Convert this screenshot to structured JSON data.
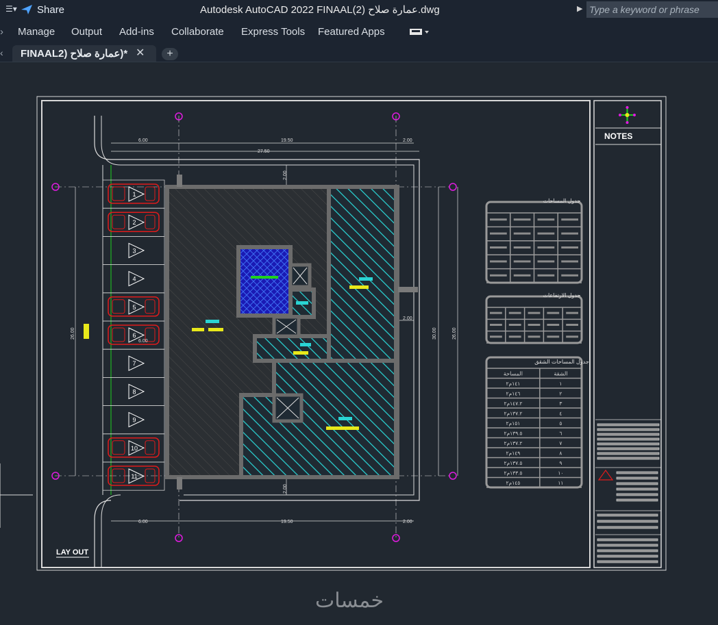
{
  "titlebar": {
    "share_label": "Share",
    "document_title": "Autodesk AutoCAD 2022    FINAALعمارة صلاح (2).dwg",
    "search_placeholder": "Type a keyword or phrase"
  },
  "menu": [
    "Manage",
    "Output",
    "Add-ins",
    "Collaborate",
    "Express Tools",
    "Featured Apps"
  ],
  "tab": {
    "label": "FINAAL2) عمارة صلاح)*"
  },
  "drawing": {
    "title": "LAY OUT",
    "notes_title": "NOTES",
    "dims_top": {
      "left": "6.00",
      "middle": "19.50",
      "right": "2.00",
      "total": "27.50"
    },
    "dims_bottom": {
      "left": "6.00",
      "middle": "19.50",
      "right": "2.00"
    },
    "dims_vertical": {
      "left": "26.00",
      "right_inner": "30.00",
      "right_outer": "26.00",
      "top_gap": "2.00",
      "bottom_gap": "2.00",
      "side_gap": "2.00"
    },
    "parking_width_label": "6.00",
    "parking": [
      "1",
      "2",
      "3",
      "4",
      "5",
      "6",
      "7",
      "8",
      "9",
      "10",
      "11"
    ],
    "cars_in_slots": [
      1,
      2,
      5,
      6,
      10,
      11
    ],
    "table1_title": "جدول المساحات",
    "table2_title": "جدول الارتفاعات",
    "table3_title": "جدول المساحات الشقق",
    "table3_headers": [
      "الشقة",
      "المساحة"
    ],
    "table3_rows": [
      [
        "١",
        "١٤١م٢"
      ],
      [
        "٢",
        "١٤٦م٢"
      ],
      [
        "٣",
        "١٤٧.٢م٢"
      ],
      [
        "٤",
        "١٣٧.٢م٢"
      ],
      [
        "٥",
        "١٥١م٢"
      ],
      [
        "٦",
        "١٣٩.٥م٢"
      ],
      [
        "٧",
        "١٣٧.٢م٢"
      ],
      [
        "٨",
        "١٤٩م٢"
      ],
      [
        "٩",
        "١٣٧.٥م٢"
      ],
      [
        "١٠",
        "١٣٣.٥م٢"
      ],
      [
        "١١",
        "١٤٥م٢"
      ]
    ]
  },
  "watermark": "خمسات",
  "colors": {
    "canvas": "#212830",
    "chrome": "#1c2430",
    "hatch_cyan": "#2ad3d3",
    "stair_blue": "#1a1ab4",
    "car_red": "#e01b1b",
    "grid_magenta": "#e01be0",
    "text_yellow": "#e8e81a",
    "text_white": "#ffffff"
  }
}
